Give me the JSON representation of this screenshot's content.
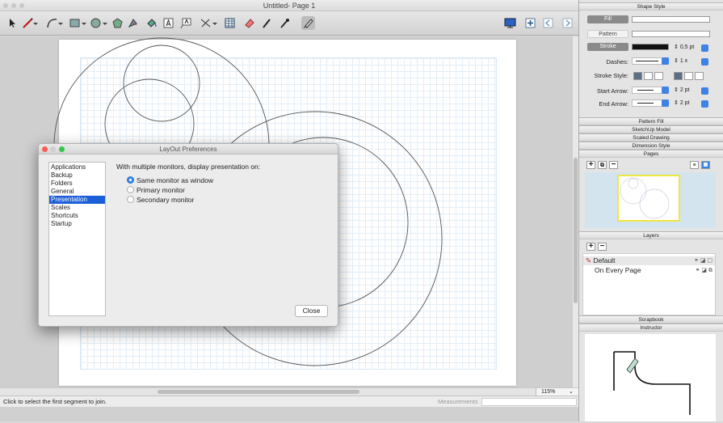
{
  "window": {
    "title": "Untitled- Page 1"
  },
  "dialog": {
    "title": "LayOut Preferences",
    "categories": [
      "Applications",
      "Backup",
      "Folders",
      "General",
      "Presentation",
      "Scales",
      "Shortcuts",
      "Startup"
    ],
    "selected_category": "Presentation",
    "heading": "With multiple monitors, display presentation on:",
    "options": [
      "Same monitor as window",
      "Primary monitor",
      "Secondary monitor"
    ],
    "selected_option": "Same monitor as window",
    "close_label": "Close"
  },
  "status": {
    "message": "Click to select the first segment to join.",
    "measurements_label": "Measurements",
    "zoom": "115%"
  },
  "panel": {
    "shape_style": {
      "header": "Shape Style",
      "fill_label": "Fill",
      "pattern_label": "Pattern",
      "stroke_label": "Stroke",
      "stroke_width": "0,5 pt",
      "dashes_label": "Dashes:",
      "dash_scale": "1 x",
      "stroke_style_label": "Stroke Style:",
      "start_arrow_label": "Start Arrow:",
      "start_arrow_size": "2 pt",
      "end_arrow_label": "End Arrow:",
      "end_arrow_size": "2 pt"
    },
    "sections": [
      "Pattern Fill",
      "SketchUp Model",
      "Scaled Drawing",
      "Dimension Style",
      "Pages"
    ],
    "layers_header": "Layers",
    "layers": [
      "Default",
      "On Every Page"
    ],
    "scrapbook_header": "Scrapbook",
    "instructor_header": "Instructor"
  },
  "colors": {
    "selection": "#1c5fd6",
    "radio_on": "#3a86ea",
    "page_highlight": "#f0e640"
  }
}
